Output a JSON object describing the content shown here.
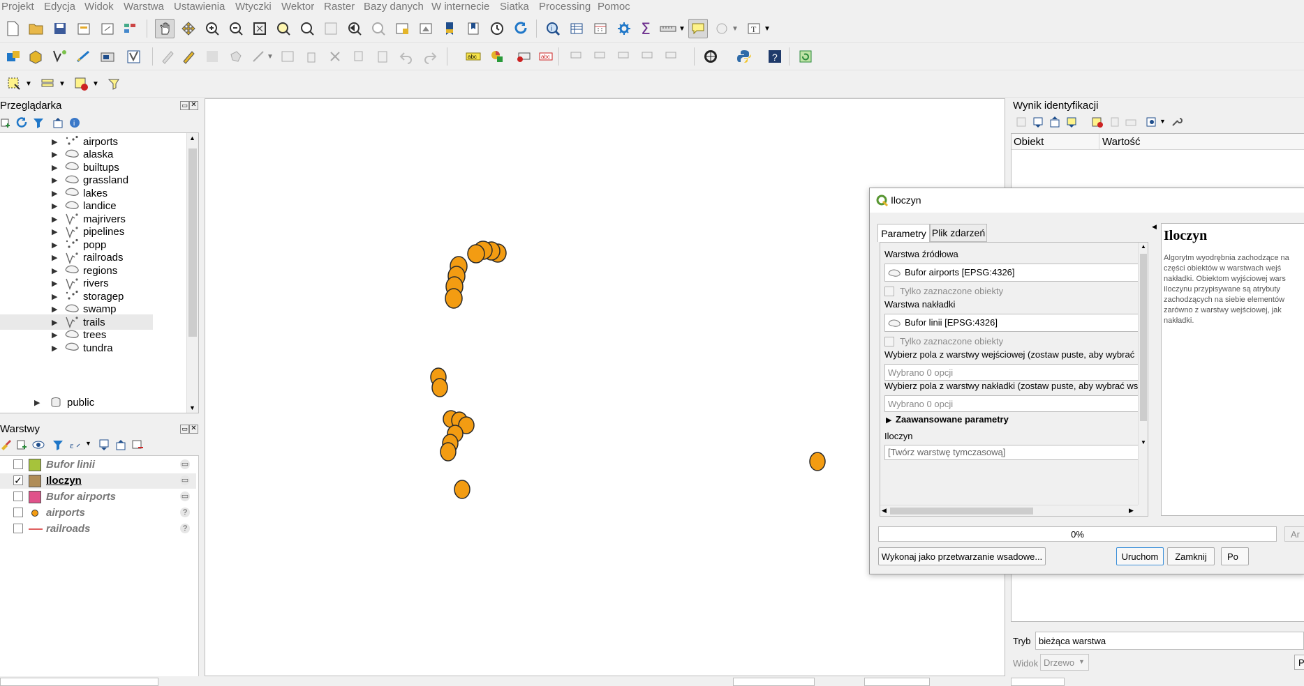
{
  "menu": [
    "Projekt",
    "Edycja",
    "Widok",
    "Warstwa",
    "Ustawienia",
    "Wtyczki",
    "Wektor",
    "Raster",
    "Bazy danych",
    "W internecie",
    "Siatka",
    "Processing",
    "Pomoc"
  ],
  "colors": {
    "feature_fill": "#f39c12",
    "accent": "#3a8fd9",
    "qgis_green": "#589632"
  },
  "browser": {
    "title": "Przeglądarka",
    "items": [
      {
        "label": "airports",
        "icon": "point-layer-icon"
      },
      {
        "label": "alaska",
        "icon": "polygon-layer-icon"
      },
      {
        "label": "builtups",
        "icon": "polygon-layer-icon"
      },
      {
        "label": "grassland",
        "icon": "polygon-layer-icon"
      },
      {
        "label": "lakes",
        "icon": "polygon-layer-icon"
      },
      {
        "label": "landice",
        "icon": "polygon-layer-icon"
      },
      {
        "label": "majrivers",
        "icon": "line-layer-icon"
      },
      {
        "label": "pipelines",
        "icon": "line-layer-icon"
      },
      {
        "label": "popp",
        "icon": "point-layer-icon"
      },
      {
        "label": "railroads",
        "icon": "line-layer-icon"
      },
      {
        "label": "regions",
        "icon": "polygon-layer-icon"
      },
      {
        "label": "rivers",
        "icon": "line-layer-icon"
      },
      {
        "label": "storagep",
        "icon": "point-layer-icon"
      },
      {
        "label": "swamp",
        "icon": "polygon-layer-icon"
      },
      {
        "label": "trails",
        "icon": "line-layer-icon"
      },
      {
        "label": "trees",
        "icon": "polygon-layer-icon"
      },
      {
        "label": "tundra",
        "icon": "polygon-layer-icon"
      }
    ],
    "schema": "public"
  },
  "layers": {
    "title": "Warstwy",
    "items": [
      {
        "name": "Bufor linii",
        "checked": false,
        "swatch": "#a6c33b",
        "tag": "▭"
      },
      {
        "name": "Iloczyn",
        "checked": true,
        "swatch": "#b08d57",
        "tag": "▭"
      },
      {
        "name": "Bufor airports",
        "checked": false,
        "swatch": "#e0528a",
        "tag": "▭"
      },
      {
        "name": "airports",
        "checked": false,
        "swatch": "point",
        "tag": "?"
      },
      {
        "name": "railroads",
        "checked": false,
        "swatch": "line",
        "tag": "?"
      }
    ]
  },
  "identify": {
    "title": "Wynik identyfikacji",
    "col_feature": "Obiekt",
    "col_value": "Wartość",
    "mode_label": "Tryb",
    "mode_value": "bieżąca warstwa",
    "view_label": "Widok",
    "view_value": "Drzewo"
  },
  "dialog": {
    "title": "Iloczyn",
    "tab_params": "Parametry",
    "tab_log": "Plik zdarzeń",
    "input_layer_label": "Warstwa źródłowa",
    "input_layer_value": "Bufor airports [EPSG:4326]",
    "selected_only_1": "Tylko zaznaczone obiekty",
    "overlay_layer_label": "Warstwa nakładki",
    "overlay_layer_value": "Bufor linii [EPSG:4326]",
    "selected_only_2": "Tylko zaznaczone obiekty",
    "input_fields_label": "Wybierz pola z warstwy wejściowej (zostaw puste, aby wybrać",
    "input_fields_value": "Wybrano 0 opcji",
    "overlay_fields_label": "Wybierz pola z warstwy nakładki (zostaw puste, aby wybrać ws",
    "overlay_fields_value": "Wybrano 0 opcji",
    "advanced": "Zaawansowane parametry",
    "output_label": "Iloczyn",
    "output_value": "[Twórz warstwę tymczasową]",
    "help_title": "Iloczyn",
    "help_text": "Algorytm wyodrębnia zachodzące na części obiektów w warstwach wejś nakładki. Obiektom wyjściowej wars Iloczynu przypisywane są atrybuty zachodzących na siebie elementów zarówno z warstwy wejściowej, jak nakładki.",
    "progress_label": "0%",
    "progress": 0,
    "batch_button": "Wykonaj jako przetwarzanie wsadowe...",
    "run_button": "Uruchom",
    "close_button": "Zamknij",
    "cut_button_right": "Po",
    "cut_button_top": "Ar"
  }
}
